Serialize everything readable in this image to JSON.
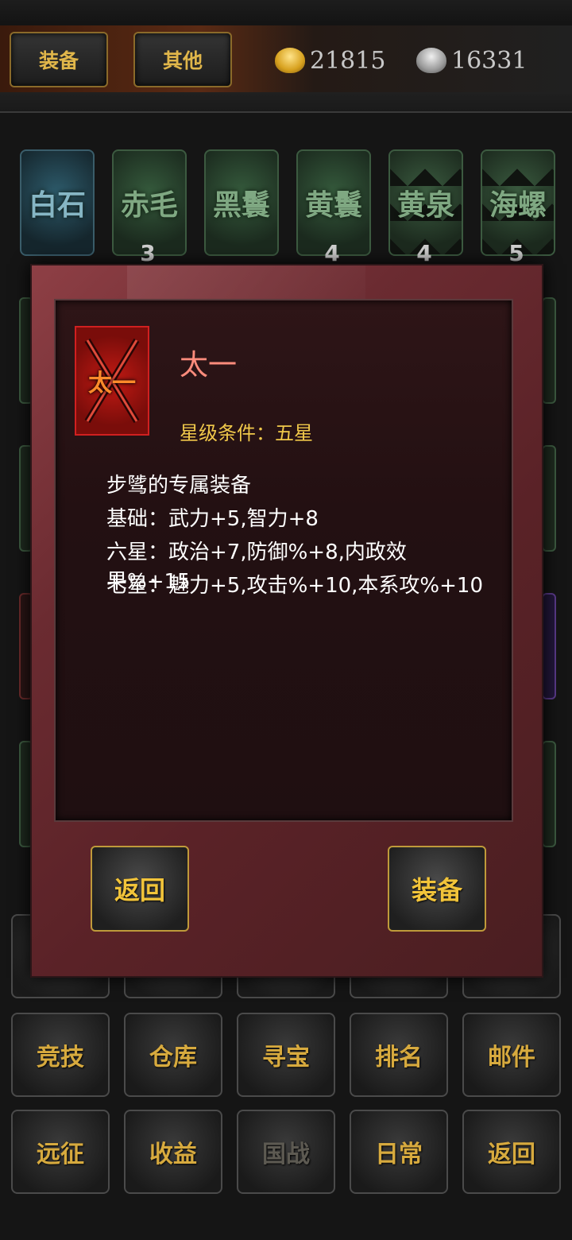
{
  "top": {
    "buttons": [
      "装备",
      "其他"
    ],
    "gold": "21815",
    "silver": "16331"
  },
  "tiles": [
    {
      "label": "白石",
      "count": ""
    },
    {
      "label": "赤毛",
      "count": "3"
    },
    {
      "label": "黑鬟",
      "count": ""
    },
    {
      "label": "黄鬟",
      "count": "4"
    },
    {
      "label": "黄泉",
      "count": "4"
    },
    {
      "label": "海螺",
      "count": "5"
    }
  ],
  "grid": {
    "row1": [
      "竞技",
      "仓库",
      "寻宝",
      "排名",
      "邮件"
    ],
    "row2": [
      "远征",
      "收益",
      "国战",
      "日常",
      "返回"
    ]
  },
  "modal": {
    "icon_text": "太一",
    "name": "太一",
    "star_condition": "星级条件：五星",
    "desc": [
      "步骘的专属装备",
      "基础：武力+5,智力+8",
      "六星：政治+7,防御%+8,内政效果%+15",
      "七星：魅力+5,攻击%+10,本系攻%+10"
    ],
    "back": "返回",
    "equip": "装备"
  },
  "colors": {
    "accent_gold": "#e0b64a",
    "item_name": "#ff8c7c",
    "star_condition": "#f0c84a"
  }
}
